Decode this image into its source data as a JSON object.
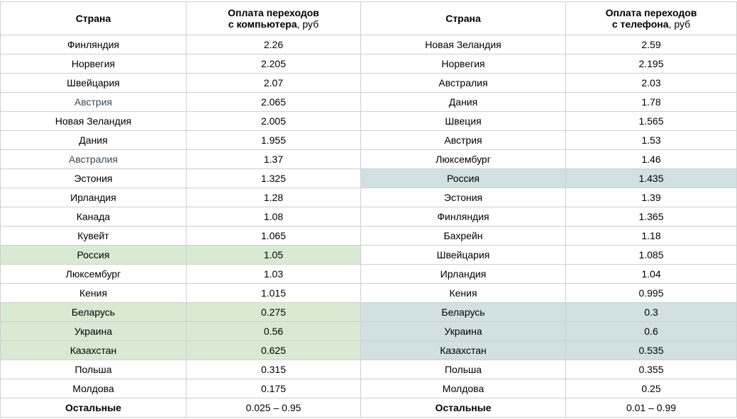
{
  "headers": {
    "country": "Страна",
    "pc_line1": "Оплата переходов",
    "pc_line2_bold": "с компьютера",
    "pc_unit": ", руб",
    "phone_line1": "Оплата переходов",
    "phone_line2_bold": "с телефона",
    "phone_unit": ", руб"
  },
  "rows": [
    {
      "pc_country": "Финляндия",
      "pc_value": "2.26",
      "ph_country": "Новая Зеландия",
      "ph_value": "2.59",
      "pc_hl": "",
      "ph_hl": ""
    },
    {
      "pc_country": "Норвегия",
      "pc_value": "2.205",
      "ph_country": "Норвегия",
      "ph_value": "2.195",
      "pc_hl": "",
      "ph_hl": ""
    },
    {
      "pc_country": "Швейцария",
      "pc_value": "2.07",
      "ph_country": "Австралия",
      "ph_value": "2.03",
      "pc_hl": "",
      "ph_hl": ""
    },
    {
      "pc_country": "Австрия",
      "pc_value": "2.065",
      "ph_country": "Дания",
      "ph_value": "1.78",
      "pc_hl": "muted",
      "ph_hl": ""
    },
    {
      "pc_country": "Новая Зеландия",
      "pc_value": "2.005",
      "ph_country": "Швеция",
      "ph_value": "1.565",
      "pc_hl": "",
      "ph_hl": ""
    },
    {
      "pc_country": "Дания",
      "pc_value": "1.955",
      "ph_country": "Австрия",
      "ph_value": "1.53",
      "pc_hl": "",
      "ph_hl": ""
    },
    {
      "pc_country": "Австралия",
      "pc_value": "1.37",
      "ph_country": "Люксембург",
      "ph_value": "1.46",
      "pc_hl": "muted",
      "ph_hl": ""
    },
    {
      "pc_country": "Эстония",
      "pc_value": "1.325",
      "ph_country": "Россия",
      "ph_value": "1.435",
      "pc_hl": "",
      "ph_hl": "blue"
    },
    {
      "pc_country": "Ирландия",
      "pc_value": "1.28",
      "ph_country": "Эстония",
      "ph_value": "1.39",
      "pc_hl": "",
      "ph_hl": ""
    },
    {
      "pc_country": "Канада",
      "pc_value": "1.08",
      "ph_country": "Финляндия",
      "ph_value": "1.365",
      "pc_hl": "",
      "ph_hl": ""
    },
    {
      "pc_country": "Кувейт",
      "pc_value": "1.065",
      "ph_country": "Бахрейн",
      "ph_value": "1.18",
      "pc_hl": "",
      "ph_hl": ""
    },
    {
      "pc_country": "Россия",
      "pc_value": "1.05",
      "ph_country": "Швейцария",
      "ph_value": "1.085",
      "pc_hl": "green",
      "ph_hl": ""
    },
    {
      "pc_country": "Люксембург",
      "pc_value": "1.03",
      "ph_country": "Ирландия",
      "ph_value": "1.04",
      "pc_hl": "",
      "ph_hl": ""
    },
    {
      "pc_country": "Кения",
      "pc_value": "1.015",
      "ph_country": "Кения",
      "ph_value": "0.995",
      "pc_hl": "",
      "ph_hl": ""
    },
    {
      "pc_country": "Беларусь",
      "pc_value": "0.275",
      "ph_country": "Беларусь",
      "ph_value": "0.3",
      "pc_hl": "green",
      "ph_hl": "blue"
    },
    {
      "pc_country": "Украина",
      "pc_value": "0.56",
      "ph_country": "Украина",
      "ph_value": "0.6",
      "pc_hl": "green",
      "ph_hl": "blue"
    },
    {
      "pc_country": "Казахстан",
      "pc_value": "0.625",
      "ph_country": "Казахстан",
      "ph_value": "0.535",
      "pc_hl": "green",
      "ph_hl": "blue"
    },
    {
      "pc_country": "Польша",
      "pc_value": "0.315",
      "ph_country": "Польша",
      "ph_value": "0.355",
      "pc_hl": "",
      "ph_hl": ""
    },
    {
      "pc_country": "Молдова",
      "pc_value": "0.175",
      "ph_country": "Молдова",
      "ph_value": "0.25",
      "pc_hl": "",
      "ph_hl": ""
    }
  ],
  "totals": {
    "pc_country": "Остальные",
    "pc_value": "0.025 – 0.95",
    "ph_country": "Остальные",
    "ph_value": "0.01 – 0.99"
  },
  "colors": {
    "green_highlight": "#d9ead3",
    "blue_highlight": "#d0e0e3",
    "border": "#cfcfcf"
  }
}
